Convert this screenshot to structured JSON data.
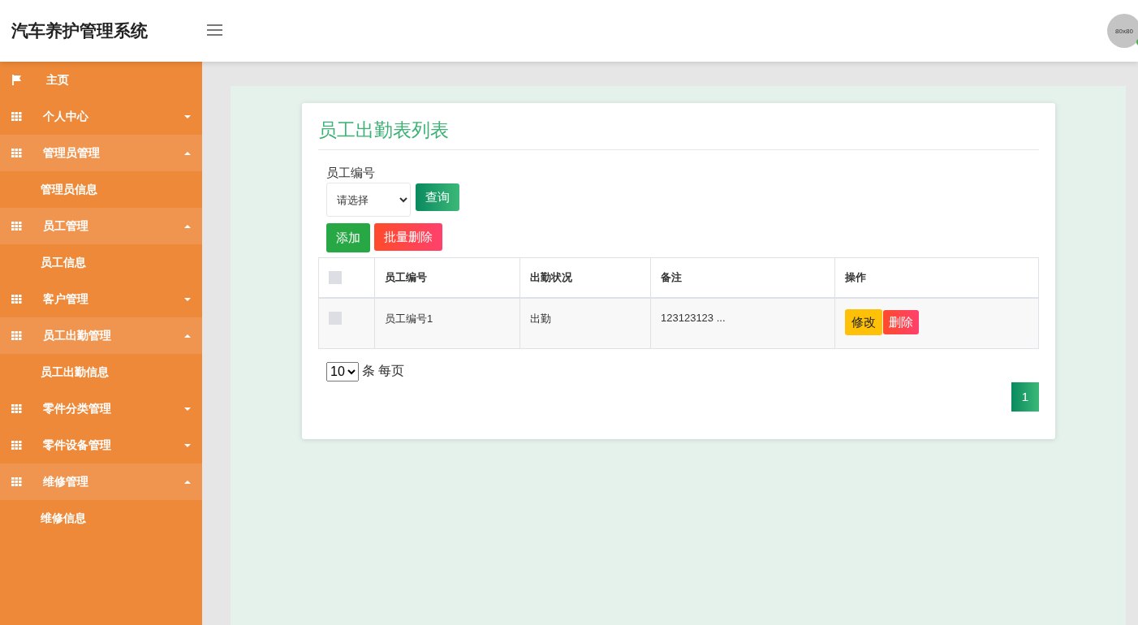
{
  "header": {
    "title": "汽车养护管理系统",
    "avatar_text": "80x80",
    "online": true
  },
  "sidebar": {
    "items": [
      {
        "kind": "home",
        "label": "主页"
      },
      {
        "kind": "group",
        "label": "个人中心",
        "expanded": false
      },
      {
        "kind": "group",
        "label": "管理员管理",
        "expanded": true,
        "children": [
          {
            "label": "管理员信息"
          }
        ]
      },
      {
        "kind": "group",
        "label": "员工管理",
        "expanded": true,
        "children": [
          {
            "label": "员工信息"
          }
        ]
      },
      {
        "kind": "group",
        "label": "客户管理",
        "expanded": false
      },
      {
        "kind": "group",
        "label": "员工出勤管理",
        "expanded": true,
        "children": [
          {
            "label": "员工出勤信息"
          }
        ]
      },
      {
        "kind": "group",
        "label": "零件分类管理",
        "expanded": false
      },
      {
        "kind": "group",
        "label": "零件设备管理",
        "expanded": false
      },
      {
        "kind": "group",
        "label": "维修管理",
        "expanded": true,
        "children": [
          {
            "label": "维修信息"
          }
        ]
      }
    ]
  },
  "card": {
    "title": "员工出勤表列表",
    "filter": {
      "label": "员工编号",
      "value": "请选择",
      "search_button": "查询"
    },
    "actions": [
      {
        "kind": "add",
        "label": "添加"
      },
      {
        "kind": "delete",
        "label": "批量删除"
      }
    ],
    "table": {
      "select_all_checked": false,
      "columns": [
        "员工编号",
        "出勤状况",
        "备注",
        "操作"
      ],
      "rows": [
        {
          "checked": false,
          "cells": [
            "员工编号1",
            "出勤",
            "123123123 ..."
          ],
          "buttons": [
            {
              "kind": "edit",
              "label": "修改"
            },
            {
              "kind": "delete",
              "label": "删除"
            }
          ]
        }
      ]
    },
    "page_size": {
      "value": "10",
      "suffix": "条 每页"
    },
    "pages": [
      {
        "label": "1",
        "selected": true
      }
    ]
  }
}
